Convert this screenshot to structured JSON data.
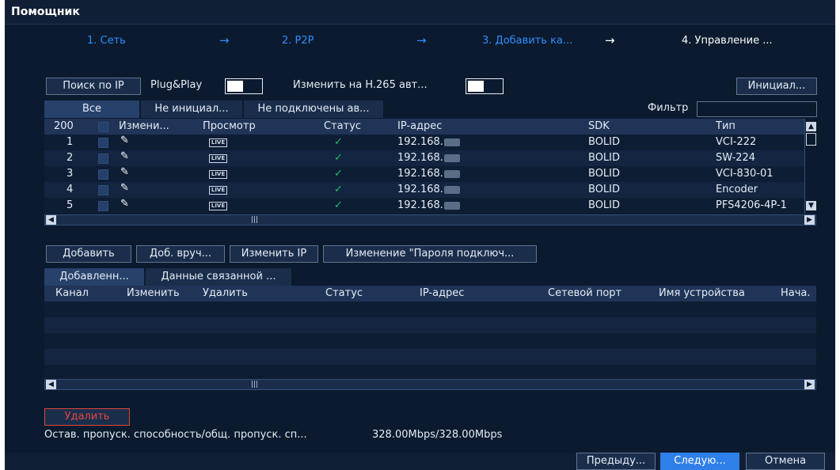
{
  "window": {
    "title": "Помощник"
  },
  "steps": [
    "1. Сеть",
    "2. P2P",
    "3. Добавить ка...",
    "4. Управление ..."
  ],
  "toolbar": {
    "search_ip": "Поиск по IP",
    "plug_play": "Plug&Play",
    "h265": "Изменить на H.265 авт...",
    "init": "Инициал..."
  },
  "filter_tabs": [
    "Все",
    "Не инициал...",
    "Не подключены ав..."
  ],
  "filter_label": "Фильтр",
  "device_table": {
    "headers": {
      "count": "200",
      "edit": "Измени...",
      "view": "Просмотр",
      "status": "Статус",
      "ip": "IP-адрес",
      "sdk": "SDK",
      "type": "Тип"
    },
    "rows": [
      {
        "n": "1",
        "ip": "192.168.",
        "sdk": "BOLID",
        "type": "VCI-222"
      },
      {
        "n": "2",
        "ip": "192.168.",
        "sdk": "BOLID",
        "type": "SW-224"
      },
      {
        "n": "3",
        "ip": "192.168.",
        "sdk": "BOLID",
        "type": "VCI-830-01"
      },
      {
        "n": "4",
        "ip": "192.168.",
        "sdk": "BOLID",
        "type": "Encoder"
      },
      {
        "n": "5",
        "ip": "192.168.",
        "sdk": "BOLID",
        "type": "PFS4206-4P-1"
      }
    ],
    "live_label": "LIVE"
  },
  "actions": {
    "add": "Добавить",
    "add_manual": "Доб. вруч...",
    "change_ip": "Изменить IP",
    "change_pass": "Изменение \"Пароля подключ..."
  },
  "added_tabs": [
    "Добавленн...",
    "Данные связанной ..."
  ],
  "added_table": {
    "headers": {
      "channel": "Канал",
      "edit": "Изменить",
      "delete": "Удалить",
      "status": "Статус",
      "ip": "IP-адрес",
      "port": "Сетевой порт",
      "name": "Имя устройства",
      "start": "Нача."
    }
  },
  "delete_button": "Удалить",
  "bandwidth": {
    "label": "Остав. пропуск. способность/общ. пропуск. сп...",
    "value": "328.00Mbps/328.00Mbps"
  },
  "footer": {
    "prev": "Предыду...",
    "next": "Следую...",
    "cancel": "Отмена"
  },
  "colors": {
    "accent": "#2f7fe8",
    "danger": "#e0453e",
    "ok": "#1ec26a",
    "bg": "#0b1a2e"
  }
}
